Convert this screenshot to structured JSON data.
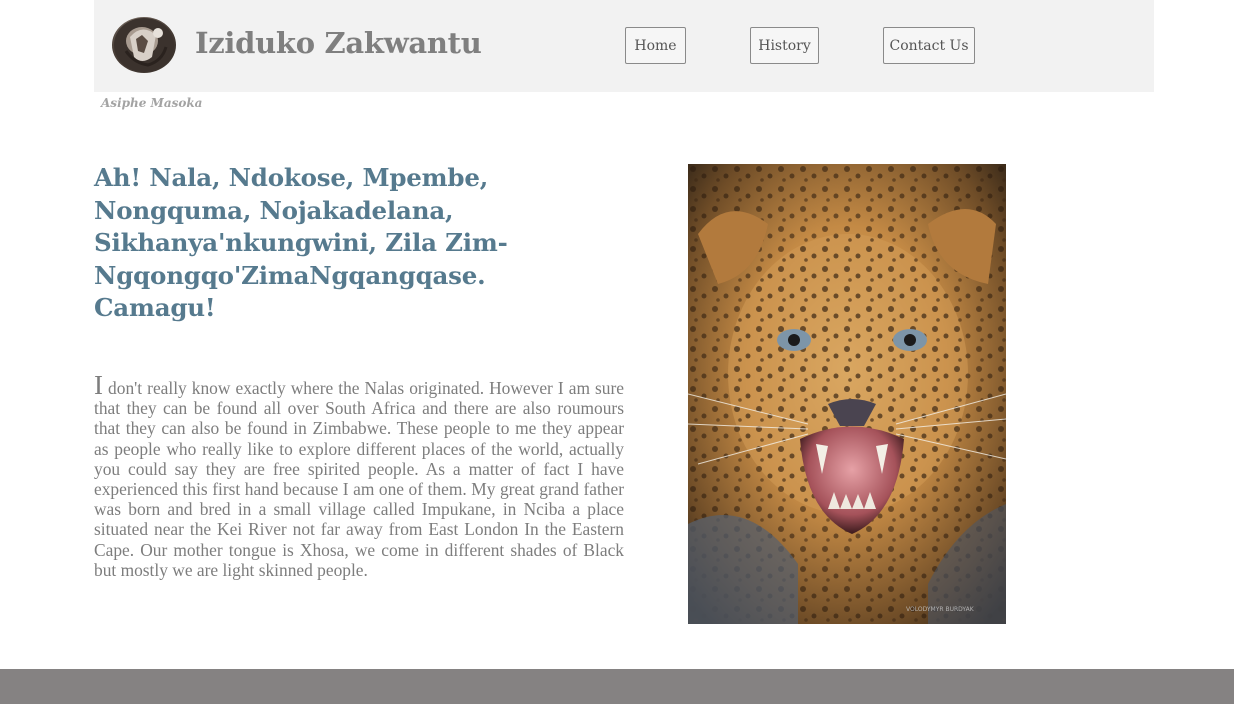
{
  "header": {
    "site_title": "Iziduko Zakwantu",
    "logo_icon": "carved-figure-logo-icon",
    "nav": [
      {
        "label": "Home"
      },
      {
        "label": "History"
      },
      {
        "label": "Contact Us"
      }
    ],
    "background_color": "#f2f2f2"
  },
  "author": "Asiphe Masoka",
  "main": {
    "headline": "Ah! Nala, Ndokose, Mpembe, Nongquma, Nojakadelana, Sikhanya'nkungwini, Zila Zim-Ngqongqo'ZimaNgqangqase. Camagu!",
    "body": "I don't really know exactly where the Nalas originated. However I am sure that they can be found all over South Africa and there are also roumours that they can also be found in Zimbabwe. These people to me they appear as people who really like to explore different places of the world, actually you could say they are free spirited people. As a matter of fact I have experienced this first hand because I am one of them. My great grand father was born and bred in a small village called Impukane, in Nciba a place situated near the Kei River not far away from East London In the Eastern Cape. Our mother tongue is Xhosa, we come in different shades of Black but mostly we are light skinned people.",
    "image": {
      "subject": "leopard-snarling-photo",
      "watermark": "VOLODYMYR BURDYAK"
    }
  },
  "colors": {
    "headline": "#567a8e",
    "title": "#7f7f7f",
    "body_text": "#7d7d7d",
    "footer": "#858282"
  }
}
